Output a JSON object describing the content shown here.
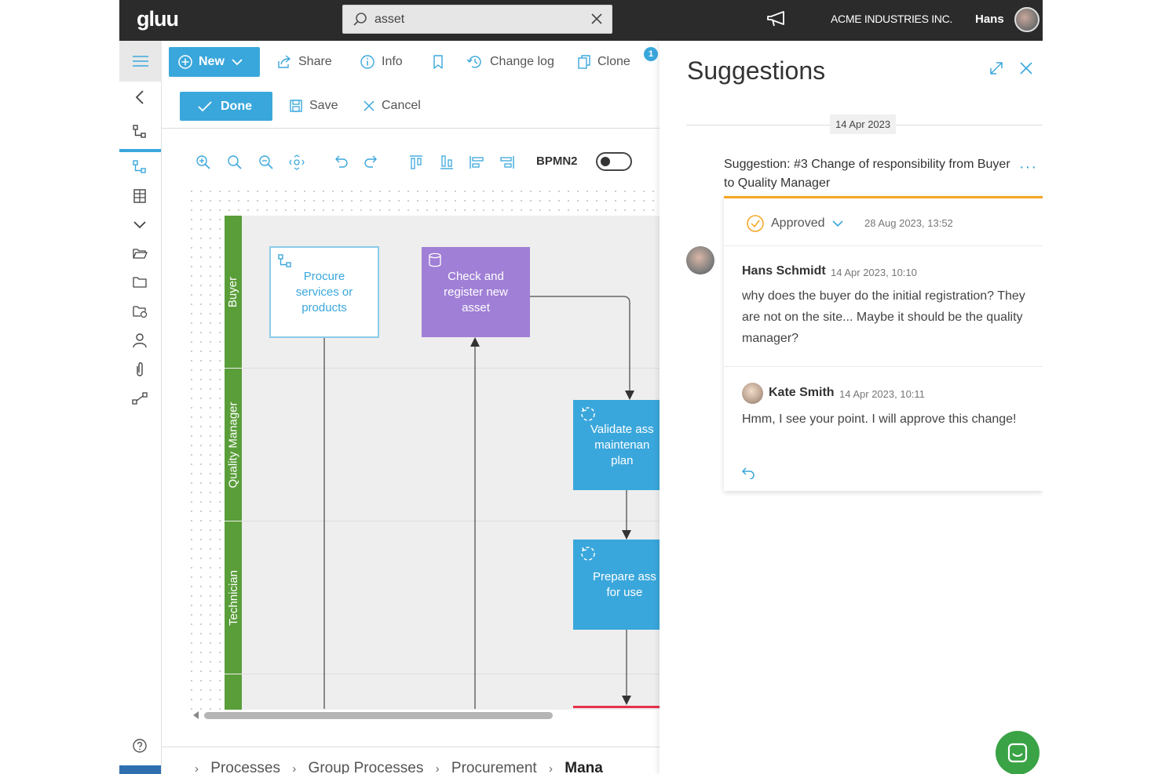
{
  "topbar": {
    "logo": "gluu",
    "search_value": "asset",
    "company": "ACME INDUSTRIES INC.",
    "username": "Hans"
  },
  "toolbar1": {
    "new_label": "New",
    "share_label": "Share",
    "info_label": "Info",
    "changelog_label": "Change log",
    "clone_label": "Clone",
    "badge_count": "1"
  },
  "toolbar2": {
    "done_label": "Done",
    "save_label": "Save",
    "cancel_label": "Cancel"
  },
  "toolbar3": {
    "bpmn_label": "BPMN2",
    "bpmn_enabled": false
  },
  "diagram": {
    "lanes": [
      "Buyer",
      "Quality Manager",
      "Technician"
    ],
    "tasks": [
      {
        "label": "Procure services or products",
        "style": "white",
        "icon": "process-icon"
      },
      {
        "label": "Check and register new asset",
        "style": "purple",
        "icon": "database-icon"
      },
      {
        "label": "Validate asset maintenance plan",
        "style": "blue",
        "icon": "loop-icon"
      },
      {
        "label": "Prepare asset for use",
        "style": "blue",
        "icon": "loop-icon"
      }
    ],
    "task1_lines": [
      "Procure",
      "services or",
      "products"
    ],
    "task2_lines": [
      "Check and",
      "register new",
      "asset"
    ],
    "task3_lines": [
      "Validate ass",
      "maintenan",
      "plan"
    ],
    "task4_lines": [
      "Prepare ass",
      "for use"
    ],
    "colors": {
      "lane": "#5a9e3a",
      "purple": "#a07fd6",
      "blue": "#3aa7dc",
      "end_line": "#e8304a"
    }
  },
  "breadcrumb": {
    "items": [
      "Processes",
      "Group Processes",
      "Procurement"
    ],
    "current": "Mana"
  },
  "suggestions": {
    "title": "Suggestions",
    "date_separator": "14 Apr 2023",
    "suggestion_title": "Suggestion: #3 Change of responsibility from Buyer to Quality Manager",
    "status": "Approved",
    "status_date": "28 Aug 2023, 13:52",
    "comments": [
      {
        "author": "Hans Schmidt",
        "time": "14 Apr 2023, 10:10",
        "text": "why does the buyer do the initial registration? They are not on the site... Maybe it should be the quality manager?"
      },
      {
        "author": "Kate Smith",
        "time": "14 Apr 2023, 10:11",
        "text": "Hmm, I see your point. I will approve this change!"
      }
    ]
  }
}
